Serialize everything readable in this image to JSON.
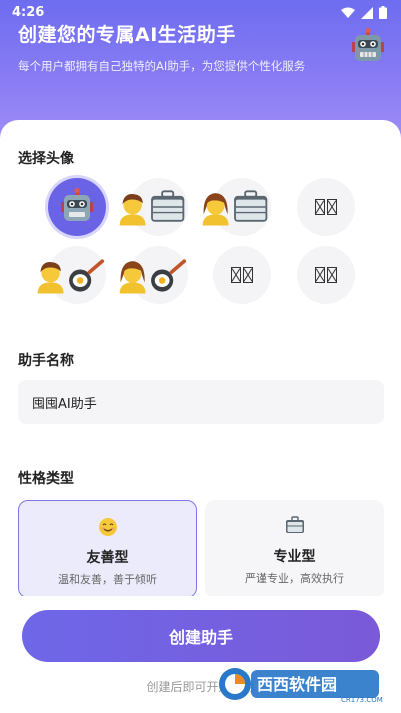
{
  "status_bar": {
    "time": "4:26"
  },
  "header": {
    "title": "创建您的专属AI生活助手",
    "subtitle": "每个用户都拥有自己独特的AI助手，为您提供个性化服务",
    "robot_icon": "robot-emoji"
  },
  "avatar_section": {
    "label": "选择头像",
    "avatars": [
      {
        "icon": "robot-emoji",
        "selected": true
      },
      {
        "icon": "person-briefcase-emoji",
        "selected": false
      },
      {
        "icon": "woman-briefcase-emoji",
        "selected": false
      },
      {
        "icon": "missing-glyph",
        "selected": false
      },
      {
        "icon": "person-cooking-emoji",
        "selected": false
      },
      {
        "icon": "woman-cooking-emoji",
        "selected": false
      },
      {
        "icon": "missing-glyph",
        "selected": false
      },
      {
        "icon": "missing-glyph",
        "selected": false
      }
    ]
  },
  "name_section": {
    "label": "助手名称",
    "value": "囤囤AI助手"
  },
  "personality_section": {
    "label": "性格类型",
    "options": [
      {
        "icon": "smiling-face-icon",
        "title": "友善型",
        "desc": "温和友善，善于倾听",
        "selected": true
      },
      {
        "icon": "briefcase-icon",
        "title": "专业型",
        "desc": "严谨专业，高效执行",
        "selected": false
      }
    ]
  },
  "create_button": {
    "label": "创建助手"
  },
  "hint": {
    "text": "创建后即可开始使用"
  },
  "watermark": {
    "text": "西西软件园",
    "sub": "CR173.COM"
  },
  "colors": {
    "accent": "#6e67e8",
    "header_top": "#6d6df0",
    "header_bottom": "#a291f6"
  }
}
